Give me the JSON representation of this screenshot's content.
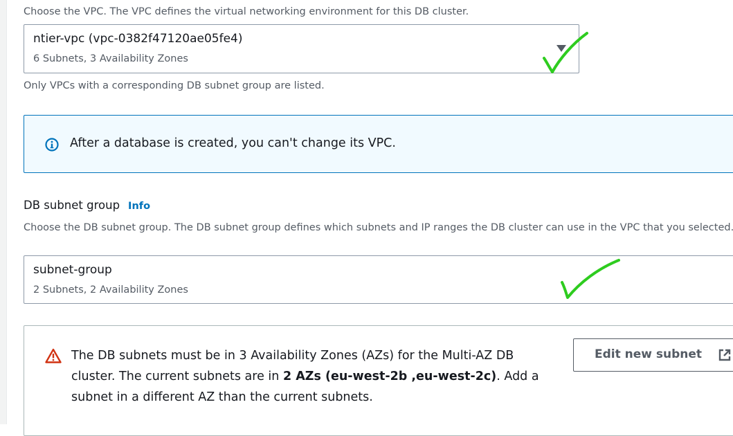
{
  "vpc": {
    "description": "Choose the VPC. The VPC defines the virtual networking environment for this DB cluster.",
    "selected_value": "ntier-vpc (vpc-0382f47120ae05fe4)",
    "selected_detail": "6 Subnets, 3 Availability Zones",
    "constraint": "Only VPCs with a corresponding DB subnet group are listed."
  },
  "info_alert": {
    "icon": "info-circle-icon",
    "text": "After a database is created, you can't change its VPC."
  },
  "subnet_group": {
    "label": "DB subnet group",
    "info_link": "Info",
    "description": "Choose the DB subnet group. The DB subnet group defines which subnets and IP ranges the DB cluster can use in the VPC that you selected.",
    "selected_value": "subnet-group",
    "selected_detail": "2 Subnets, 2 Availability Zones"
  },
  "warning_alert": {
    "icon": "warning-triangle-icon",
    "text_before": "The DB subnets must be in 3 Availability Zones (AZs) for the Multi-AZ DB cluster. The current subnets are in ",
    "text_bold": "2 AZs (eu-west-2b ,eu-west-2c)",
    "text_after": ". Add a subnet in a different AZ than the current subnets.",
    "button_label": "Edit new subnet",
    "button_icon": "external-link-icon"
  },
  "colors": {
    "info_border": "#0073bb",
    "info_background": "#f1faff",
    "warning_icon": "#d13212",
    "link": "#0073bb",
    "annotation_check": "#2ecc1f"
  }
}
